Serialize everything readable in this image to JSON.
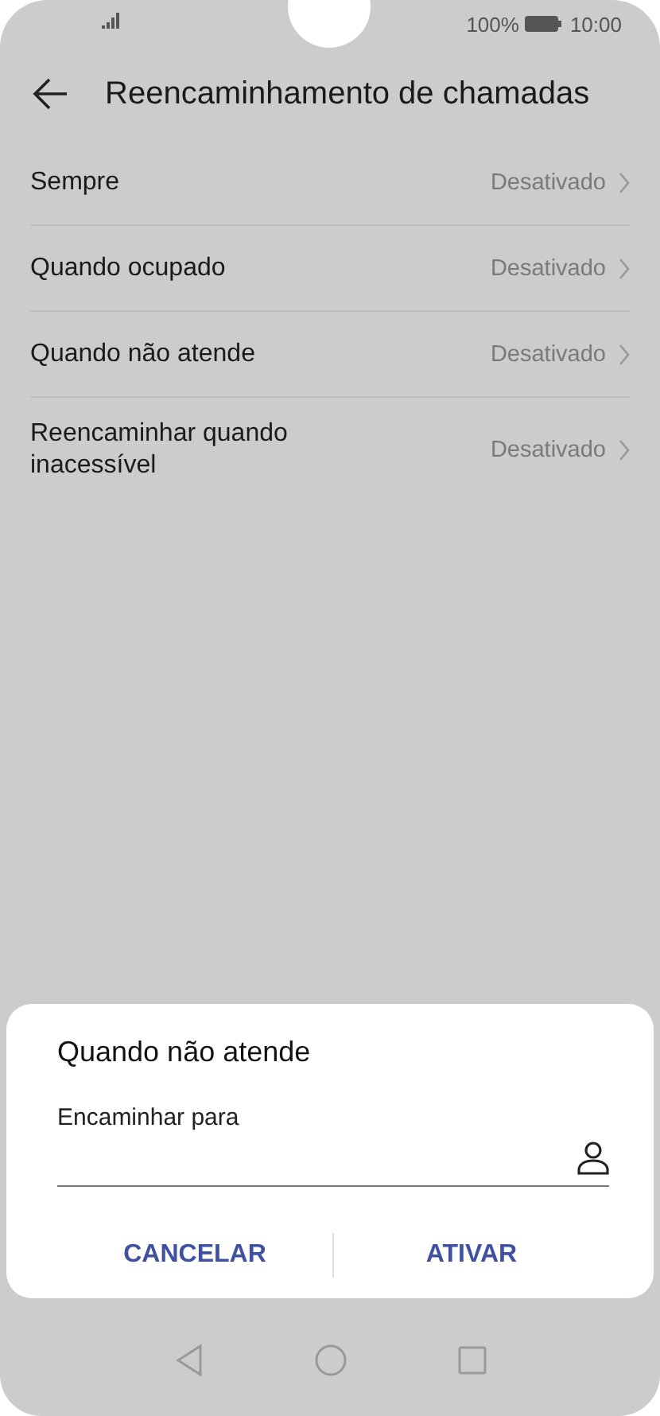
{
  "status_bar": {
    "battery": "100%",
    "time": "10:00"
  },
  "header": {
    "title": "Reencaminhamento de chamadas"
  },
  "settings": [
    {
      "label": "Sempre",
      "value": "Desativado"
    },
    {
      "label": "Quando ocupado",
      "value": "Desativado"
    },
    {
      "label": "Quando não atende",
      "value": "Desativado"
    },
    {
      "label": "Reencaminhar quando inacessível",
      "value": "Desativado"
    }
  ],
  "dialog": {
    "title": "Quando não atende",
    "field_label": "Encaminhar para",
    "buttons": [
      "CANCELAR",
      "ATIVAR"
    ]
  }
}
